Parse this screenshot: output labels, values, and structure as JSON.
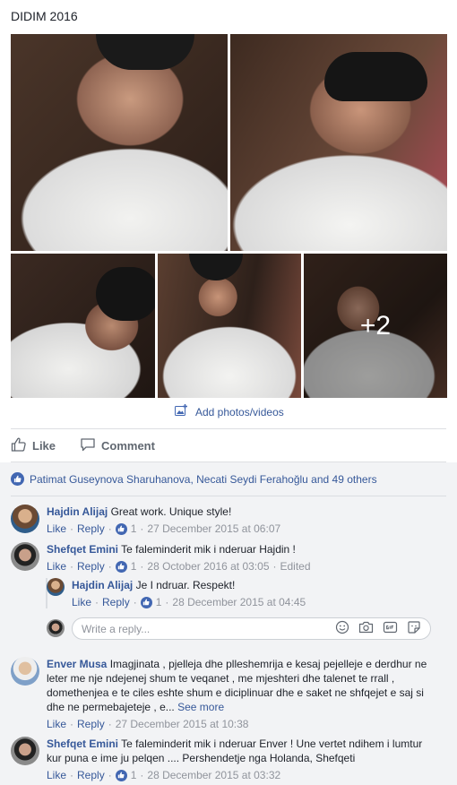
{
  "album": {
    "title": "DIDIM 2016",
    "more_count": "+2"
  },
  "add_photos_label": "Add photos/videos",
  "actions": {
    "like_label": "Like",
    "comment_label": "Comment"
  },
  "likes_summary": "Patimat Guseynova Sharuhanova, Necati Seydi Ferahoğlu and 49 others",
  "comments": [
    {
      "author": "Hajdin Alijaj",
      "text": "Great work. Unique style!",
      "like": "Like",
      "reply": "Reply",
      "reactions": "1",
      "time": "27 December 2015 at 06:07"
    },
    {
      "author": "Shefqet Emini",
      "text": "Te faleminderit mik i nderuar Hajdin !",
      "like": "Like",
      "reply": "Reply",
      "reactions": "1",
      "time": "28 October 2016 at 03:05",
      "edited": "Edited",
      "replies": [
        {
          "author": "Hajdin Alijaj",
          "text": "Je I ndruar. Respekt!",
          "like": "Like",
          "reply": "Reply",
          "reactions": "1",
          "time": "28 December 2015 at 04:45"
        }
      ]
    },
    {
      "author": "Enver Musa",
      "text": "Imagjinata , pjelleja dhe plleshemrija e kesaj pejelleje e derdhur ne leter me nje ndejenej shum te veqanet , me mjeshteri dhe talenet te rrall , domethenjea e te ciles eshte shum e diciplinuar dhe e saket ne shfqejet e saj si dhe ne permebajeteje , e...",
      "see_more": "See more",
      "like": "Like",
      "reply": "Reply",
      "time": "27 December 2015 at 10:38"
    },
    {
      "author": "Shefqet Emini",
      "text": "Te faleminderit mik i nderuar Enver ! Une vertet ndihem i lumtur kur puna e ime ju pelqen .... Pershendetje nga Holanda, Shefqeti",
      "like": "Like",
      "reply": "Reply",
      "reactions": "1",
      "time": "28 December 2015 at 03:32"
    }
  ],
  "reply_input": {
    "placeholder": "Write a reply..."
  },
  "colors": {
    "link": "#365899",
    "like_blue": "#4267b2",
    "meta_gray": "#90949c",
    "section_bg": "#f2f3f5"
  }
}
